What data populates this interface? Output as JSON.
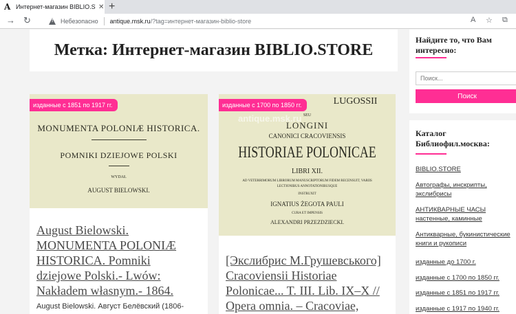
{
  "browser": {
    "tab_title": "Интернет-магазин BIBLIO.STORE",
    "tab_favicon": "A",
    "tab_close": "✕",
    "new_tab": "+",
    "security_label": "Небезопасно",
    "url_host": "antique.msk.ru",
    "url_path": "/?tag=интернет-магазин-biblio-store",
    "icons": [
      "back-arrow-icon",
      "reload-icon",
      "warning-icon",
      "read-aloud-icon",
      "favorites-star-icon",
      "collections-icon"
    ]
  },
  "page": {
    "title": "Метка: Интернет-магазин BIBLIO.STORE"
  },
  "posts": [
    {
      "badge": "изданные с 1851 по 1917 гг.",
      "image_text": {
        "line1": "MONUMENTA POLONIÆ HISTORICA.",
        "line2": "POMNIKI DZIEJOWE POLSKI",
        "line3": "WYDAŁ",
        "line4": "AUGUST BIELOWSKI."
      },
      "title": "August Bielowski. MONUMENTA POLONIÆ HISTORICA. Pomniki dziejowe Polski.- Lwów: Nakładem własnym.- 1864.",
      "excerpt": "August Bielowski. Август Белёвский (1806-"
    },
    {
      "badge": "изданные с 1700 по 1850 гг.",
      "image_text": {
        "watermark": "antique.msk.ru",
        "line1": "LUGOSSII",
        "line2": "SEU",
        "line3": "LONGINI",
        "line4": "CANONICI CRACOVIENSIS",
        "line5": "HISTORIAE POLONICAE",
        "line6": "LIBRI XII.",
        "line7": "AD VETERRIMORUM LIBRORUM MANUSCRIPTORUM FIDEM RECENSUIT, VARIIS",
        "line8": "LECTIONIBUS ANNOTATIONIBUSQUE",
        "line9": "INSTRUXIT",
        "line10": "IGNATIUS ŻEGOTA PAULI",
        "line11": "CURA ET IMPENSIS",
        "line12": "ALEXANDRI PRZEZDZIECKI."
      },
      "title": "[Экслибрис М.Грушевського] Cracoviensii Historiae Polonicae... T. III. Lib. IX–X // Opera omnia. – Cracoviae,"
    }
  ],
  "sidebar": {
    "search": {
      "title": "Найдите то, что Вам интересно:",
      "placeholder": "Поиск...",
      "button": "Поиск"
    },
    "catalog": {
      "title": "Каталог Библиофил.москва:",
      "items": [
        "BIBLIO.STORE",
        "Автографы, инскрипты, экслибрисы",
        "АНТИКВАРНЫЕ ЧАСЫ настенные, каминные",
        "Антикварные, букинистические книги и рукописи",
        "изданные до 1700 г.",
        "изданные с 1700 по 1850 гг.",
        "изданные с 1851 по 1917 гг.",
        "изданные с 1917 по 1940 гг."
      ]
    }
  },
  "colors": {
    "accent": "#ff2e94"
  }
}
